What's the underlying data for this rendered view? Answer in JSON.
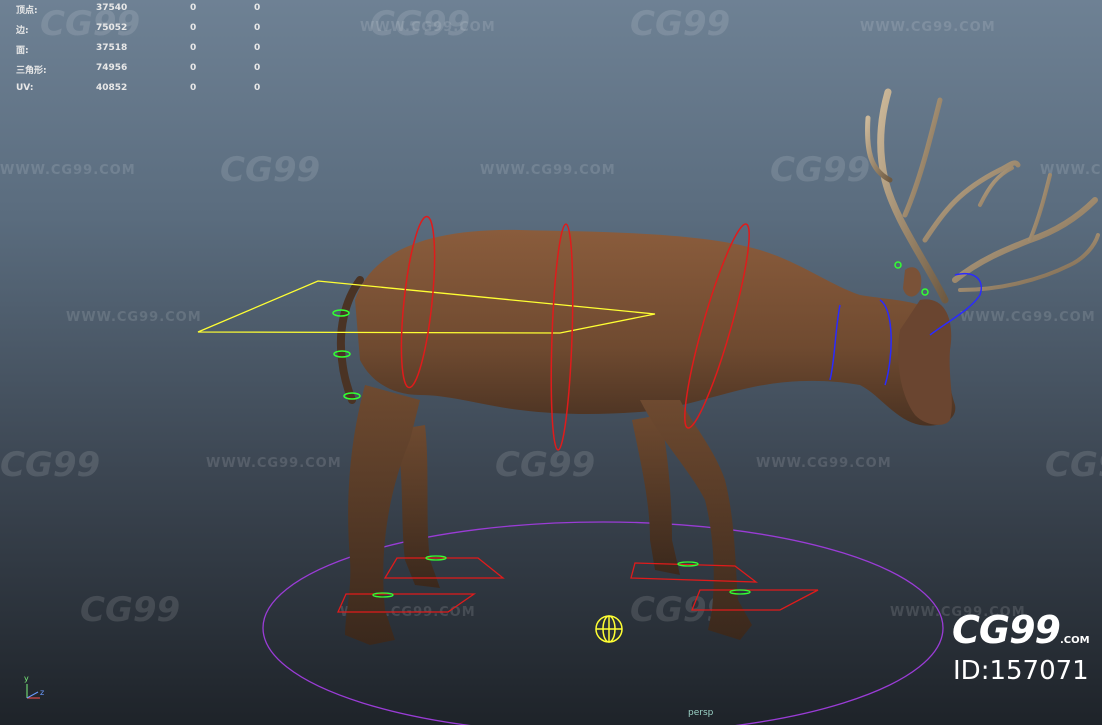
{
  "stats": {
    "rows": [
      {
        "label": "顶点:",
        "a": "37540",
        "b": "0",
        "c": "0"
      },
      {
        "label": "边:",
        "a": "75052",
        "b": "0",
        "c": "0"
      },
      {
        "label": "面:",
        "a": "37518",
        "b": "0",
        "c": "0"
      },
      {
        "label": "三角形:",
        "a": "74956",
        "b": "0",
        "c": "0"
      },
      {
        "label": "UV:",
        "a": "40852",
        "b": "0",
        "c": "0"
      }
    ]
  },
  "watermark": {
    "text": "WWW.CG99.COM",
    "logo": "CG99"
  },
  "brand": {
    "logo": "CG99",
    "logo_suffix": ".COM",
    "id": "ID:157071"
  },
  "viewport": {
    "camera": "persp"
  },
  "axis": {
    "y": "y",
    "z": "z"
  },
  "colors": {
    "accent_controls": "#e01b1b",
    "plane": "#ffff33",
    "ground_circle": "#9a3cd6",
    "neck_controls": "#2a2aff"
  }
}
